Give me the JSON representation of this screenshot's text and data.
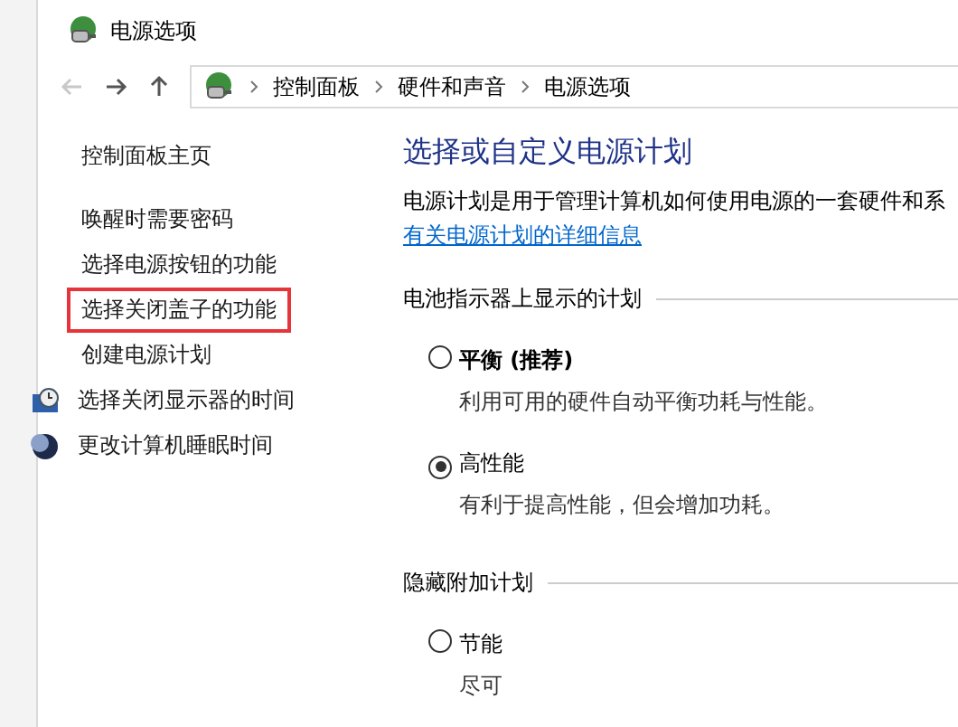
{
  "window": {
    "title": "电源选项"
  },
  "address_bar": {
    "path": [
      "控制面板",
      "硬件和声音",
      "电源选项"
    ]
  },
  "sidebar": {
    "items": [
      {
        "label": "控制面板主页",
        "highlighted": false
      },
      {
        "label": "唤醒时需要密码",
        "highlighted": false
      },
      {
        "label": "选择电源按钮的功能",
        "highlighted": false
      },
      {
        "label": "选择关闭盖子的功能",
        "highlighted": true
      },
      {
        "label": "创建电源计划",
        "highlighted": false
      },
      {
        "label": "选择关闭显示器的时间",
        "highlighted": false
      },
      {
        "label": "更改计算机睡眠时间",
        "highlighted": false
      }
    ]
  },
  "main": {
    "heading": "选择或自定义电源计划",
    "description": "电源计划是用于管理计算机如何使用电源的一套硬件和系",
    "link": "有关电源计划的详细信息",
    "groups": [
      {
        "label": "电池指示器上显示的计划",
        "plans": [
          {
            "name": "平衡 (推荐)",
            "bold": true,
            "selected": false,
            "description": "利用可用的硬件自动平衡功耗与性能。"
          },
          {
            "name": "高性能",
            "bold": false,
            "selected": true,
            "description": "有利于提高性能，但会增加功耗。"
          }
        ]
      },
      {
        "label": "隐藏附加计划",
        "plans": [
          {
            "name": "节能",
            "bold": false,
            "selected": false,
            "description": "尽可"
          }
        ]
      }
    ]
  }
}
